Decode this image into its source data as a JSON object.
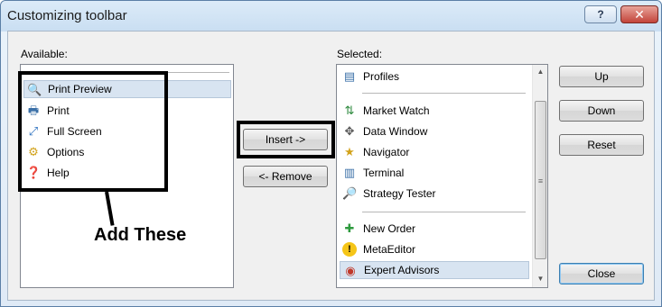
{
  "window": {
    "title": "Customizing toolbar",
    "help_glyph": "?",
    "close_glyph": "✕"
  },
  "available": {
    "label": "Available:",
    "items": [
      {
        "label": "Print Preview",
        "icon": "print-preview-icon",
        "glyph": "🔍",
        "selected": true
      },
      {
        "label": "Print",
        "icon": "print-icon",
        "glyph": "🖶",
        "selected": false
      },
      {
        "label": "Full Screen",
        "icon": "full-screen-icon",
        "glyph": "⤢",
        "selected": false
      },
      {
        "label": "Options",
        "icon": "options-icon",
        "glyph": "⚙",
        "selected": false
      },
      {
        "label": "Help",
        "icon": "help-icon",
        "glyph": "❓",
        "selected": false
      }
    ]
  },
  "selected": {
    "label": "Selected:",
    "items": [
      {
        "label": "Profiles",
        "icon": "profiles-icon",
        "glyph": "▤",
        "selected": false
      },
      {
        "label": "Market Watch",
        "icon": "market-watch-icon",
        "glyph": "⇅",
        "selected": false
      },
      {
        "label": "Data Window",
        "icon": "data-window-icon",
        "glyph": "✥",
        "selected": false
      },
      {
        "label": "Navigator",
        "icon": "navigator-icon",
        "glyph": "★",
        "selected": false
      },
      {
        "label": "Terminal",
        "icon": "terminal-icon",
        "glyph": "▥",
        "selected": false
      },
      {
        "label": "Strategy Tester",
        "icon": "strategy-tester-icon",
        "glyph": "🔎",
        "selected": false
      },
      {
        "label": "New Order",
        "icon": "new-order-icon",
        "glyph": "✚",
        "selected": false
      },
      {
        "label": "MetaEditor",
        "icon": "meta-editor-icon",
        "glyph": "!",
        "selected": false
      },
      {
        "label": "Expert Advisors",
        "icon": "expert-advisors-icon",
        "glyph": "◉",
        "selected": true
      }
    ]
  },
  "buttons": {
    "insert": "Insert ->",
    "remove": "<- Remove",
    "up": "Up",
    "down": "Down",
    "reset": "Reset",
    "close": "Close"
  },
  "annotation": {
    "text": "Add These"
  },
  "colors": {
    "selection": "#d8e4f1",
    "annotation": "#000000",
    "close_button_red": "#c3443a"
  }
}
